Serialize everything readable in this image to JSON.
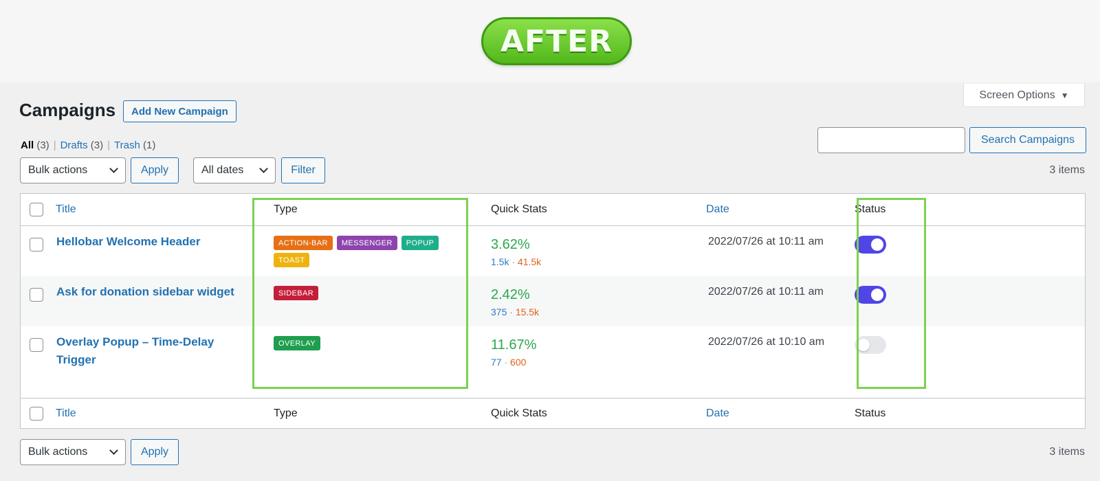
{
  "badge": {
    "label": "AFTER"
  },
  "screen_options": {
    "label": "Screen Options",
    "caret": "▼"
  },
  "header": {
    "title": "Campaigns",
    "add_new_label": "Add New Campaign"
  },
  "views": {
    "all": {
      "label": "All",
      "count": "(3)"
    },
    "drafts": {
      "label": "Drafts",
      "count": "(3)"
    },
    "trash": {
      "label": "Trash",
      "count": "(1)"
    },
    "separator": "|"
  },
  "search": {
    "placeholder": "",
    "button_label": "Search Campaigns"
  },
  "top_nav": {
    "bulk_actions": "Bulk actions",
    "apply": "Apply",
    "dates": "All dates",
    "filter": "Filter",
    "items": "3 items"
  },
  "bottom_nav": {
    "bulk_actions": "Bulk actions",
    "apply": "Apply",
    "items": "3 items"
  },
  "columns": {
    "title": "Title",
    "type": "Type",
    "stats": "Quick Stats",
    "date": "Date",
    "status": "Status"
  },
  "rows": [
    {
      "title": "Hellobar Welcome Header",
      "types": [
        {
          "label": "ACTION-BAR",
          "color": "#e67016"
        },
        {
          "label": "MESSENGER",
          "color": "#8e44ad"
        },
        {
          "label": "POPUP",
          "color": "#1fae8a"
        },
        {
          "label": "TOAST",
          "color": "#efb30f"
        }
      ],
      "percent": "3.62%",
      "views": "1.5k",
      "dot": "·",
      "conversions": "41.5k",
      "date": "2022/07/26 at 10:11 am",
      "status_on": true
    },
    {
      "title": "Ask for donation sidebar widget",
      "types": [
        {
          "label": "SIDEBAR",
          "color": "#c41e3a"
        }
      ],
      "percent": "2.42%",
      "views": "375",
      "dot": "·",
      "conversions": "15.5k",
      "date": "2022/07/26 at 10:11 am",
      "status_on": true
    },
    {
      "title": "Overlay Popup – Time-Delay Trigger",
      "types": [
        {
          "label": "OVERLAY",
          "color": "#1e9e4e"
        }
      ],
      "percent": "11.67%",
      "views": "77",
      "dot": "·",
      "conversions": "600",
      "date": "2022/07/26 at 10:10 am",
      "status_on": false
    }
  ],
  "colors": {
    "accent": "#2271b1",
    "toggle_on": "#4f46e5",
    "highlight": "#7cd152",
    "stat_green": "#2aa84a"
  }
}
